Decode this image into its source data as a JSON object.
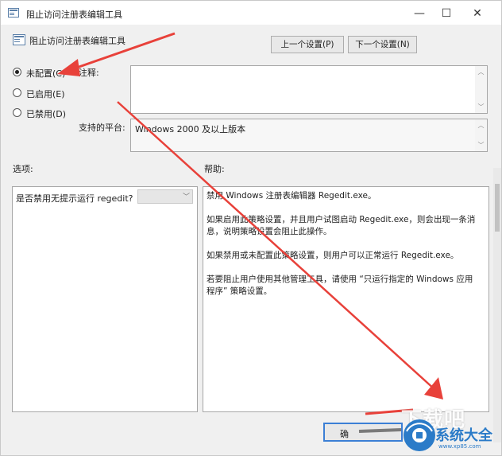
{
  "window": {
    "title": "阻止访问注册表编辑工具",
    "minimize": "—",
    "maximize": "☐",
    "close": "✕"
  },
  "header": {
    "title": "阻止访问注册表编辑工具",
    "prev_button": "上一个设置(P)",
    "next_button": "下一个设置(N)"
  },
  "state": {
    "options": [
      {
        "label": "未配置(C)",
        "selected": true
      },
      {
        "label": "已启用(E)",
        "selected": false
      },
      {
        "label": "已禁用(D)",
        "selected": false
      }
    ]
  },
  "comment": {
    "label": "注释:",
    "value": ""
  },
  "platform": {
    "label": "支持的平台:",
    "value": "Windows 2000 及以上版本"
  },
  "options_panel": {
    "label": "选项:",
    "row_label": "是否禁用无提示运行 regedit?",
    "dropdown_value": ""
  },
  "help_panel": {
    "label": "帮助:",
    "paragraphs": [
      "禁用 Windows 注册表编辑器 Regedit.exe。",
      "如果启用此策略设置，并且用户试图启动 Regedit.exe，则会出现一条消息，说明策略设置会阻止此操作。",
      "如果禁用或未配置此策略设置，则用户可以正常运行 Regedit.exe。",
      "若要阻止用户使用其他管理工具，请使用 “只运行指定的 Windows 应用程序” 策略设置。"
    ]
  },
  "footer": {
    "ok_button": "确"
  },
  "watermark": {
    "text": "系统大全",
    "sub": "www.xp85.com",
    "brand": "下载吧"
  },
  "colors": {
    "arrow": "#e8413a",
    "watermark": "#2b7bc8",
    "focus": "#3c7fd5"
  }
}
